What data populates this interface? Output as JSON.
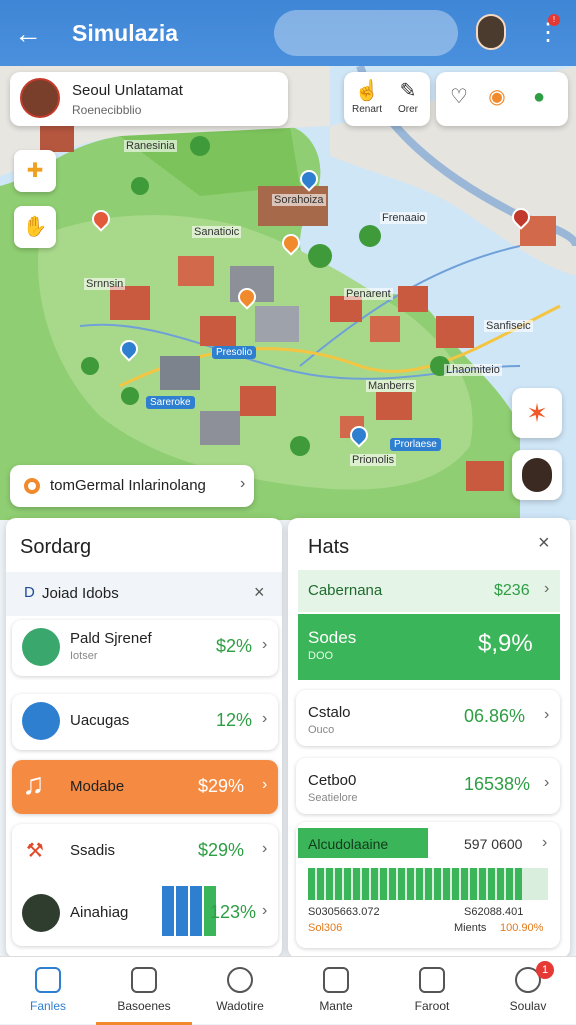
{
  "header": {
    "title": "Simulazia",
    "back_icon": "back-arrow-icon",
    "menu_icon": "kebab-menu-icon",
    "menu_badge": "!"
  },
  "profile": {
    "name": "Seoul Unlatamat",
    "subtitle": "Roenecibblio"
  },
  "map_tools": [
    {
      "label": "Renart",
      "icon": "thumb-icon"
    },
    {
      "label": "Orer",
      "icon": "pen-icon"
    }
  ],
  "map_labels": [
    "Ranesinia",
    "Sorahoiza",
    "Sanatioic",
    "Frenaaio",
    "Srnnsin",
    "Penarent",
    "Sanfiseic",
    "Presolio",
    "Lhaomiteio",
    "Sareroke",
    "Manberrs",
    "Prorlaese",
    "Prionolis"
  ],
  "route_pill": {
    "label": "tomGermal Inlarinolang"
  },
  "summary": {
    "title": "Sordarg",
    "filter": {
      "label": "Joiad Idobs"
    },
    "rows": [
      {
        "label": "Pald Sjrenef",
        "sub": "Iotser",
        "value": "$2%"
      },
      {
        "label": "Uacugas",
        "sub": "",
        "value": "12%"
      },
      {
        "label": "Modabe",
        "sub": "",
        "value": "$29%"
      },
      {
        "label": "Ssadis",
        "sub": "",
        "value": "$29%"
      },
      {
        "label": "Ainahiag",
        "sub": "",
        "value": "123%"
      }
    ]
  },
  "hats": {
    "title": "Hats",
    "rows": [
      {
        "label": "Cabernana",
        "sub": "",
        "value": "$236"
      },
      {
        "label": "Sodes",
        "sub": "DOO",
        "value": "$,9%"
      },
      {
        "label": "Cstalo",
        "sub": "Ouco",
        "value": "06.86%"
      },
      {
        "label": "Cetbo0",
        "sub": "Seatielore",
        "value": "16538%"
      }
    ],
    "progress": {
      "label": "Alcudolaaine",
      "value": "597 0600",
      "fraction": 0.9,
      "left_caption": "S0305663.072",
      "right_caption": "S62088.401",
      "left_note": "Sol306",
      "right_label": "Mients",
      "right_value": "100.90%"
    }
  },
  "nav": [
    {
      "label": "Fanles",
      "icon": "home-icon"
    },
    {
      "label": "Basoenes",
      "icon": "list-icon"
    },
    {
      "label": "Wadotire",
      "icon": "chat-icon"
    },
    {
      "label": "Mante",
      "icon": "clock-icon"
    },
    {
      "label": "Faroot",
      "icon": "folder-icon"
    },
    {
      "label": "Soulav",
      "icon": "message-icon",
      "badge": "1"
    }
  ],
  "colors": {
    "header": "#4a90dd",
    "accent_green": "#3bb55a",
    "accent_orange": "#f58b42",
    "value_green": "#2e9e44"
  }
}
